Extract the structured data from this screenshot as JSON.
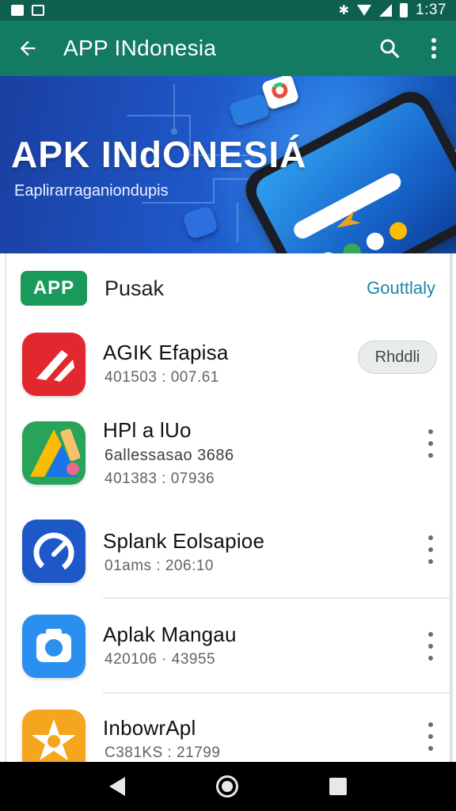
{
  "status_bar": {
    "time": "1:37"
  },
  "app_bar": {
    "title": "APP INdonesia",
    "back_icon": "arrow-left-icon",
    "search_icon": "search-icon",
    "more_icon": "more-vert-icon"
  },
  "banner": {
    "title": "APK INdONESIÁ",
    "subtitle": "Eaplirarraganiondupis"
  },
  "section": {
    "badge": "APP",
    "title": "Pusak",
    "link": "Gouttlaly"
  },
  "apps": [
    {
      "name": "AGIK Efapisa",
      "meta": "401503 : 007.61",
      "action": "Rhddli",
      "icon": "red-brand-icon"
    },
    {
      "name": "HPl a lUo",
      "meta_1": "6allessasao 3686",
      "meta_2": "401383 : 07936",
      "icon": "multicolor-a-icon"
    },
    {
      "name": "Splank Eolsapioe",
      "meta": "01ams : 206:10",
      "icon": "speedometer-icon"
    },
    {
      "name": "Aplak Mangau",
      "meta": "420106 · 43955",
      "icon": "camera-icon"
    },
    {
      "name": "InbowrApl",
      "meta": "C381KS : 21799",
      "icon": "star-icon"
    }
  ],
  "colors": {
    "status_bar": "#0e5f4e",
    "app_bar": "#137a63",
    "badge_green": "#1a9a5a",
    "link_teal": "#1a86a9"
  }
}
